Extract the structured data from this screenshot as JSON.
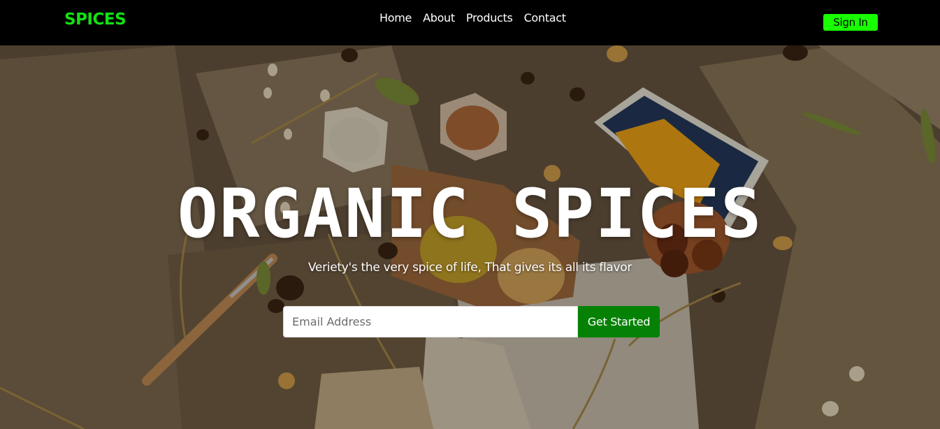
{
  "brand": {
    "logo": "SPICES",
    "accent": "#13e013"
  },
  "nav": {
    "items": [
      {
        "label": "Home"
      },
      {
        "label": "About"
      },
      {
        "label": "Products"
      },
      {
        "label": "Contact"
      }
    ],
    "signin_label": "Sign In",
    "signin_color": "#17ff00"
  },
  "hero": {
    "title": "ORGANIC SPICES",
    "subtitle": "Veriety's the very spice of life, That gives its all its flavor",
    "email_placeholder": "Email Address",
    "cta_label": "Get Started",
    "cta_color": "#058205"
  }
}
